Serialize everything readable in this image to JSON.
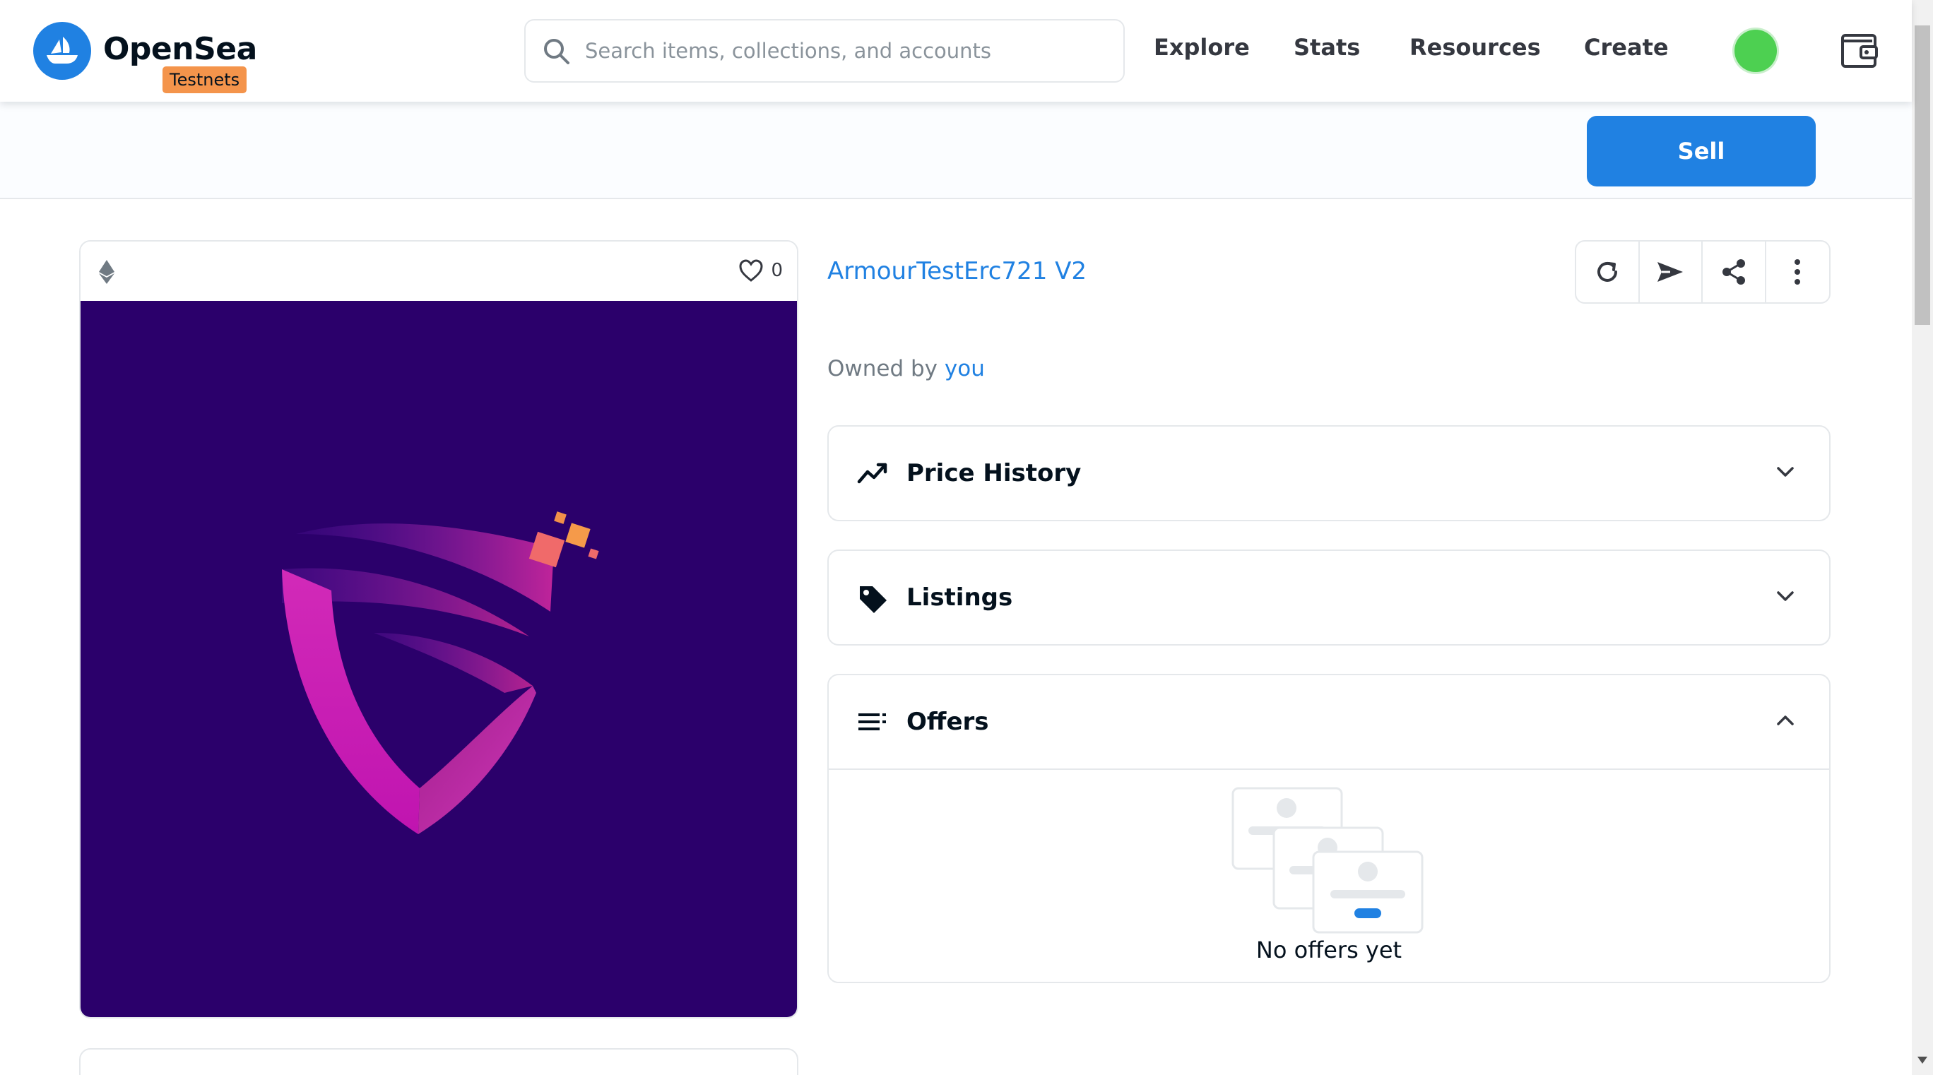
{
  "header": {
    "brand": "OpenSea",
    "badge": "Testnets",
    "search_placeholder": "Search items, collections, and accounts",
    "nav": [
      "Explore",
      "Stats",
      "Resources",
      "Create"
    ],
    "avatar_color": "#4dd051",
    "accent_color": "#2081e2"
  },
  "sell_bar": {
    "sell_label": "Sell"
  },
  "item": {
    "favorites_count": "0",
    "image_background": "#2b006b",
    "collection_name": "ArmourTestErc721 V2",
    "owned_prefix": "Owned by",
    "owner": "you"
  },
  "actions": [
    "refresh-icon",
    "transfer-icon",
    "share-icon",
    "more-icon"
  ],
  "panels": {
    "price_history": {
      "title": "Price History",
      "icon": "trending-icon",
      "expanded": false
    },
    "listings": {
      "title": "Listings",
      "icon": "tag-icon",
      "expanded": false
    },
    "offers": {
      "title": "Offers",
      "icon": "list-icon",
      "expanded": true,
      "empty_text": "No offers yet"
    }
  }
}
